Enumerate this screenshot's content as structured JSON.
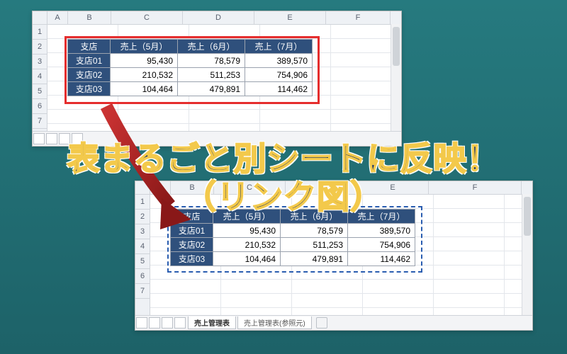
{
  "columns": [
    "A",
    "B",
    "C",
    "D",
    "E",
    "F"
  ],
  "rows": [
    "1",
    "2",
    "3",
    "4",
    "5",
    "6",
    "7"
  ],
  "table": {
    "header_label": "支店",
    "headers": [
      "売上（5月）",
      "売上（6月）",
      "売上（7月）"
    ],
    "rows": [
      {
        "name": "支店01",
        "v": [
          "95,430",
          "78,579",
          "389,570"
        ]
      },
      {
        "name": "支店02",
        "v": [
          "210,532",
          "511,253",
          "754,906"
        ]
      },
      {
        "name": "支店03",
        "v": [
          "104,464",
          "479,891",
          "114,462"
        ]
      }
    ]
  },
  "tabs": {
    "active": "売上管理表",
    "inactive": "売上管理表(参照元)"
  },
  "headline": {
    "l1": "表まるごと別シートに反映！",
    "l2": "（リンク図）"
  }
}
